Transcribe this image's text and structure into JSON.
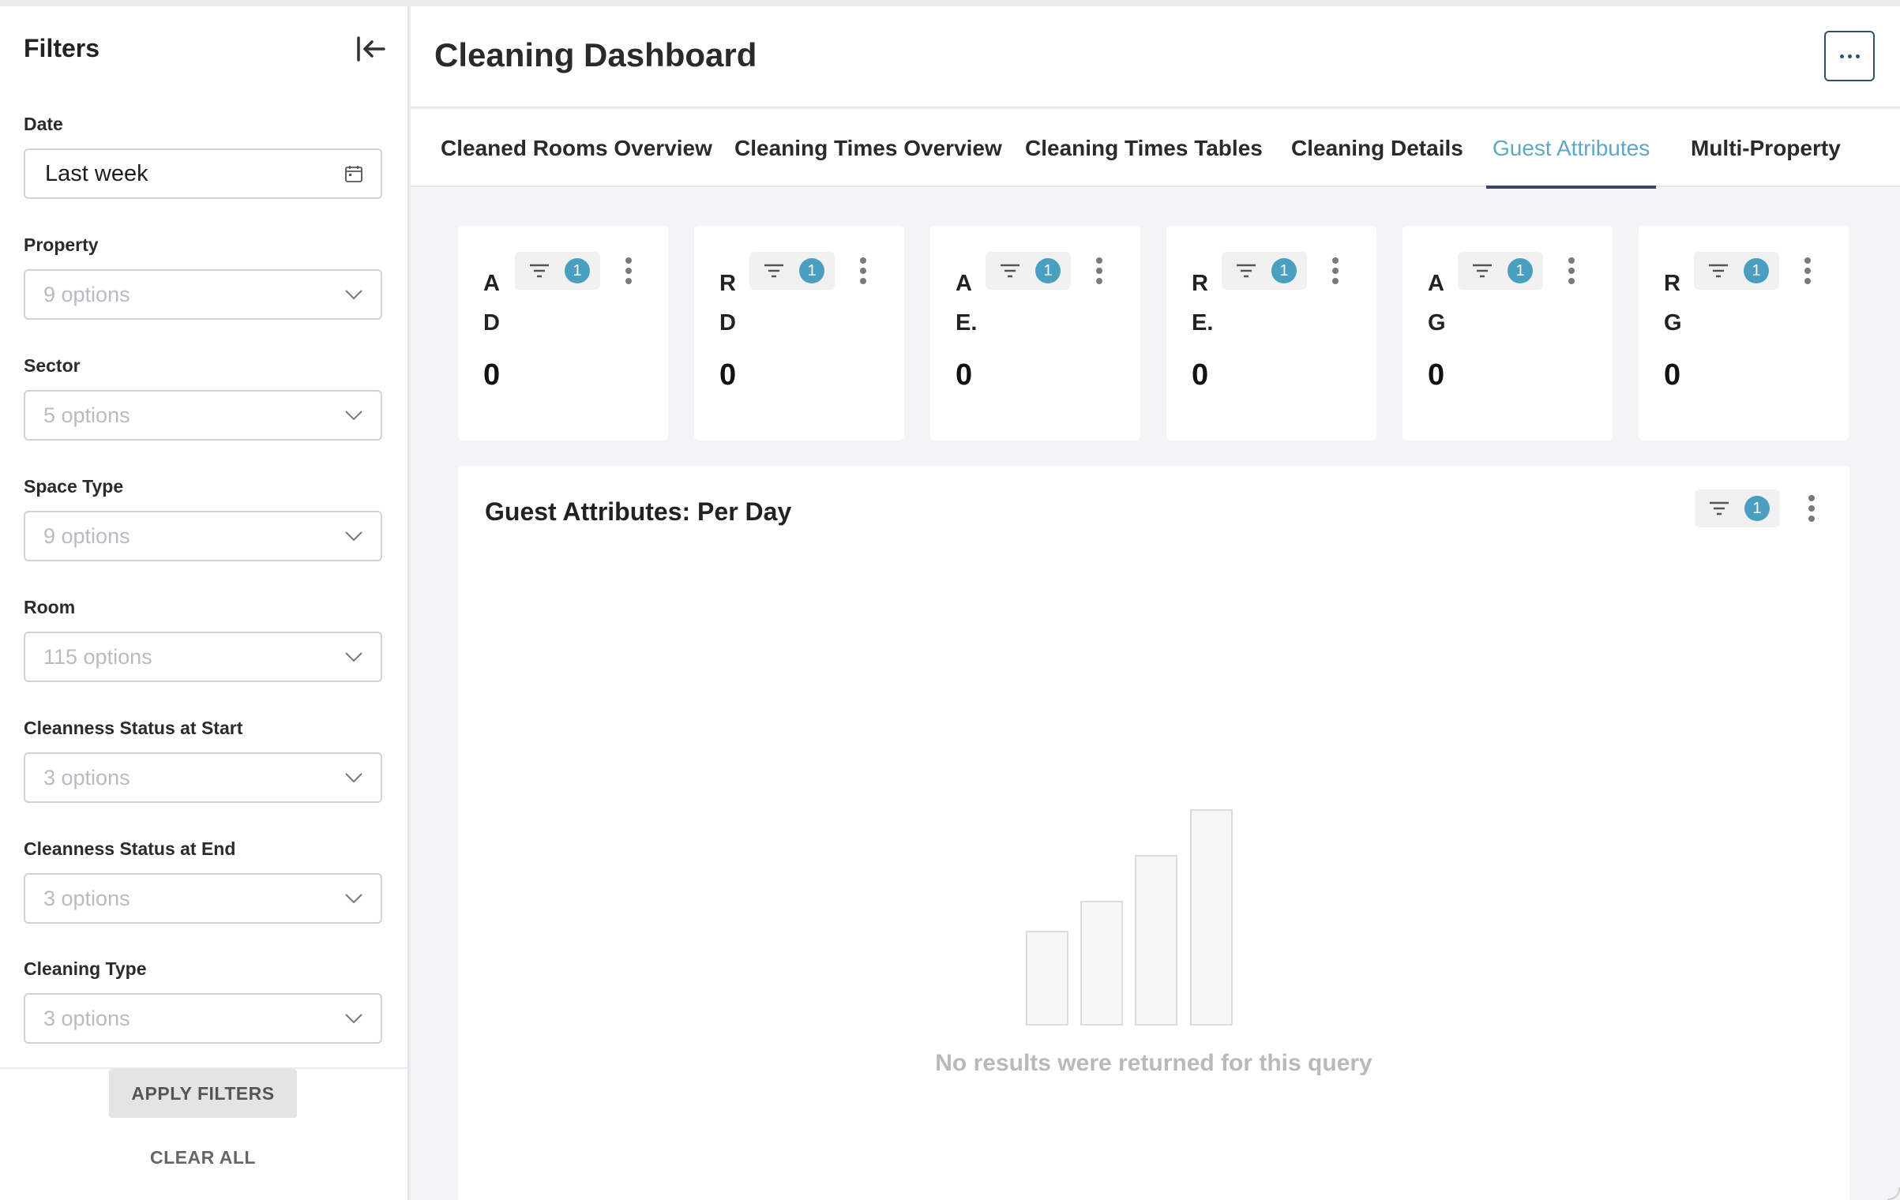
{
  "sidebar": {
    "title": "Filters",
    "filters": [
      {
        "label": "Date",
        "value": "Last week",
        "icon": "calendar-icon"
      },
      {
        "label": "Property",
        "placeholder": "9 options"
      },
      {
        "label": "Sector",
        "placeholder": "5 options"
      },
      {
        "label": "Space Type",
        "placeholder": "9 options"
      },
      {
        "label": "Room",
        "placeholder": "115 options"
      },
      {
        "label": "Cleanness Status at Start",
        "placeholder": "3 options"
      },
      {
        "label": "Cleanness Status at End",
        "placeholder": "3 options"
      },
      {
        "label": "Cleaning Type",
        "placeholder": "3 options"
      }
    ],
    "apply_label": "APPLY FILTERS",
    "clear_label": "CLEAR ALL"
  },
  "header": {
    "title": "Cleaning Dashboard"
  },
  "tabs": [
    {
      "label": "Cleaned Rooms Overview",
      "active": false
    },
    {
      "label": "Cleaning Times Overview",
      "active": false
    },
    {
      "label": "Cleaning Times Tables",
      "active": false
    },
    {
      "label": "Cleaning Details",
      "active": false
    },
    {
      "label": "Guest Attributes",
      "active": true
    },
    {
      "label": "Multi-Property",
      "active": false
    }
  ],
  "kpis": [
    {
      "line1": "A",
      "line2": "D",
      "value": "0",
      "filter_count": "1"
    },
    {
      "line1": "R",
      "line2": "D",
      "value": "0",
      "filter_count": "1"
    },
    {
      "line1": "A",
      "line2": "E.",
      "value": "0",
      "filter_count": "1"
    },
    {
      "line1": "R",
      "line2": "E.",
      "value": "0",
      "filter_count": "1"
    },
    {
      "line1": "A",
      "line2": "G",
      "value": "0",
      "filter_count": "1"
    },
    {
      "line1": "R",
      "line2": "G",
      "value": "0",
      "filter_count": "1"
    }
  ],
  "chart_panel": {
    "title": "Guest Attributes: Per Day",
    "filter_count": "1",
    "empty_message": "No results were returned for this query"
  },
  "colors": {
    "accent": "#5da8c4",
    "badge": "#4a9fc0",
    "active_tab_underline": "#3a4660",
    "placeholder": "#b7bcc2"
  }
}
